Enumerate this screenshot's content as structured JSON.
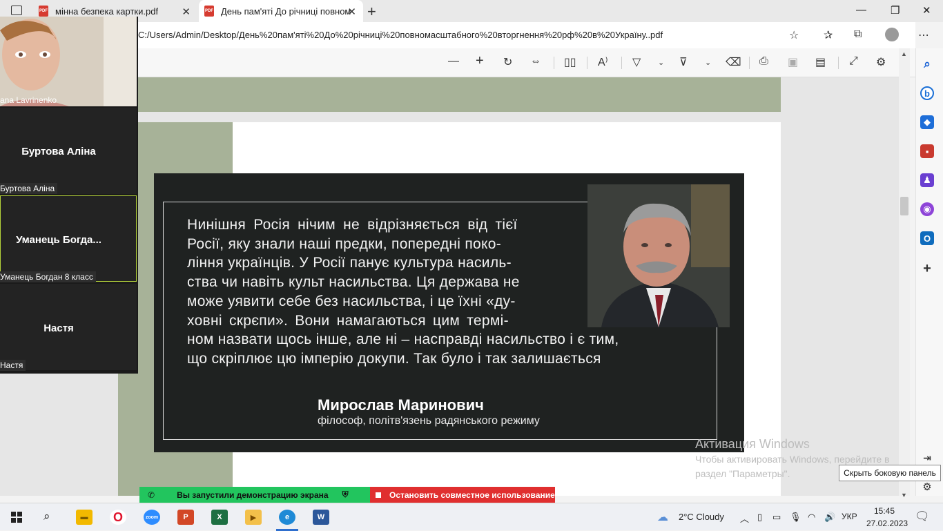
{
  "tabs": [
    {
      "label": "мінна безпека картки.pdf",
      "icon": "pdf-icon"
    },
    {
      "label": "День пам'яті До річниці повном",
      "icon": "pdf-icon"
    }
  ],
  "address": {
    "url": "C:/Users/Admin/Desktop/День%20пам'яті%20До%20річниці%20повномасштабного%20вторгнення%20рф%20в%20Україну..pdf"
  },
  "pdf": {
    "quote_lines": [
      "Нинішня Росія нічим не відрізняється від тієї",
      "Росії, яку знали наші предки, попередні поко-",
      "ління українців. У Росії панує культура насиль-",
      "ства чи навіть культ насильства. Ця держава не",
      "може уявити себе без насильства, і це їхні «ду-",
      "ховні скрєпи». Вони намагаються цим термі-",
      "ном назвати щось інше, але ні – насправді насильство і є тим,",
      "що скріплює цю імперію докупи. Так було і так залишається"
    ],
    "author_name": "Мирослав Маринович",
    "author_role": "філософ, політв'язень радянського режиму",
    "colors": {
      "page_accent": "#a7b298",
      "panel_bg": "#1f2221"
    }
  },
  "zoom": {
    "participants": [
      {
        "caption": "ana Lavrinenko",
        "has_video": true
      },
      {
        "name": "Буртова Аліна",
        "caption": "Буртова Аліна"
      },
      {
        "name": "Уманець  Богда...",
        "caption": "Уманець Богдан 8 класс",
        "active": true
      },
      {
        "name": "Настя",
        "caption": "Настя"
      }
    ],
    "share_status": "Вы запустили демонстрацию экрана",
    "stop_share": "Остановить совместное использование"
  },
  "watermark": {
    "title": "Активация Windows",
    "line1": "Чтобы активировать Windows, перейдите в",
    "line2": "раздел \"Параметры\"."
  },
  "tooltip": "Скрыть боковую панель",
  "taskbar": {
    "weather": "2°C  Cloudy",
    "lang": "УКР",
    "time": "15:45",
    "date": "27.02.2023"
  }
}
